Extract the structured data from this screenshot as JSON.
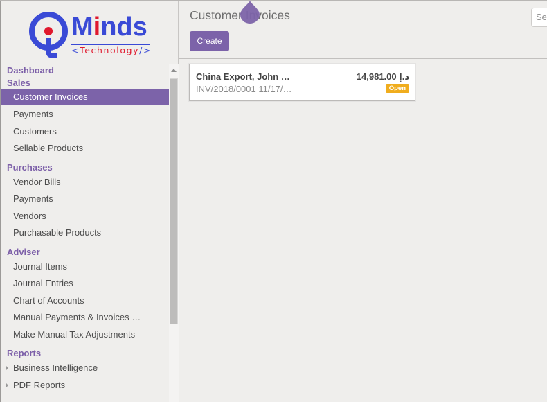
{
  "brand": {
    "name_prefix": "M",
    "name_highlight": "i",
    "name_suffix": "nds",
    "tagline_open": "<",
    "tagline": "Technology",
    "tagline_close": "/>",
    "colors": {
      "primary": "#3a4ad6",
      "accent": "#e0182d"
    }
  },
  "theme": {
    "accent": "#7c63a9",
    "badge_open": "#f0ad1e"
  },
  "sidebar": {
    "sections": [
      {
        "label": "Dashboard",
        "items": []
      },
      {
        "label": "Sales",
        "items": [
          {
            "label": "Customer Invoices",
            "active": true
          },
          {
            "label": "Payments"
          },
          {
            "label": "Customers"
          },
          {
            "label": "Sellable Products"
          }
        ]
      },
      {
        "label": "Purchases",
        "items": [
          {
            "label": "Vendor Bills"
          },
          {
            "label": "Payments"
          },
          {
            "label": "Vendors"
          },
          {
            "label": "Purchasable Products"
          }
        ]
      },
      {
        "label": "Adviser",
        "items": [
          {
            "label": "Journal Items"
          },
          {
            "label": "Journal Entries"
          },
          {
            "label": "Chart of Accounts"
          },
          {
            "label": "Manual Payments & Invoices …"
          },
          {
            "label": "Make Manual Tax Adjustments"
          }
        ]
      },
      {
        "label": "Reports",
        "items": [
          {
            "label": "Business Intelligence",
            "expandable": true
          },
          {
            "label": "PDF Reports",
            "expandable": true
          }
        ]
      }
    ]
  },
  "main": {
    "title": "Customer Invoices",
    "create_label": "Create",
    "search_placeholder": "Se"
  },
  "invoices": [
    {
      "partner": "China Export, John …",
      "reference": "INV/2018/0001 11/17/…",
      "amount": "14,981.00 د.إ",
      "status": "Open"
    }
  ]
}
